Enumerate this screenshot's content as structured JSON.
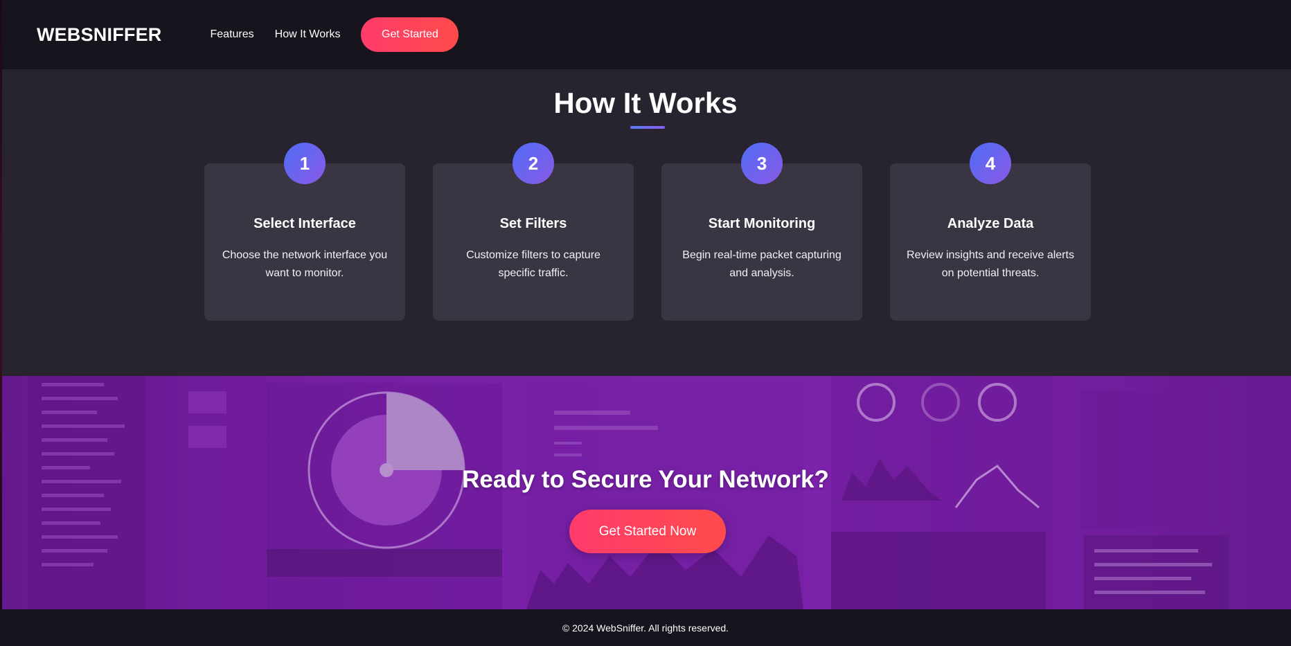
{
  "nav": {
    "logo": "WEBSNIFFER",
    "links": [
      "Features",
      "How It Works"
    ],
    "cta_label": "Get Started"
  },
  "how": {
    "title": "How It Works",
    "steps": [
      {
        "number": "1",
        "title": "Select Interface",
        "description": "Choose the network interface you want to monitor."
      },
      {
        "number": "2",
        "title": "Set Filters",
        "description": "Customize filters to capture specific traffic."
      },
      {
        "number": "3",
        "title": "Start Monitoring",
        "description": "Begin real-time packet capturing and analysis."
      },
      {
        "number": "4",
        "title": "Analyze Data",
        "description": "Review insights and receive alerts on potential threats."
      }
    ]
  },
  "cta": {
    "title": "Ready to Secure Your Network?",
    "button_label": "Get Started Now"
  },
  "footer": {
    "copyright": "© 2024 WebSniffer. All rights reserved."
  },
  "colors": {
    "accent_gradient_start": "#ff3b6b",
    "accent_gradient_end": "#ff4b4b",
    "step_badge_start": "#4f6cf5",
    "step_badge_end": "#8a5ae6",
    "banner_purple": "#6c1f99",
    "nav_bg": "#17141d",
    "section_bg": "#27232f",
    "card_bg": "#3a3542"
  }
}
